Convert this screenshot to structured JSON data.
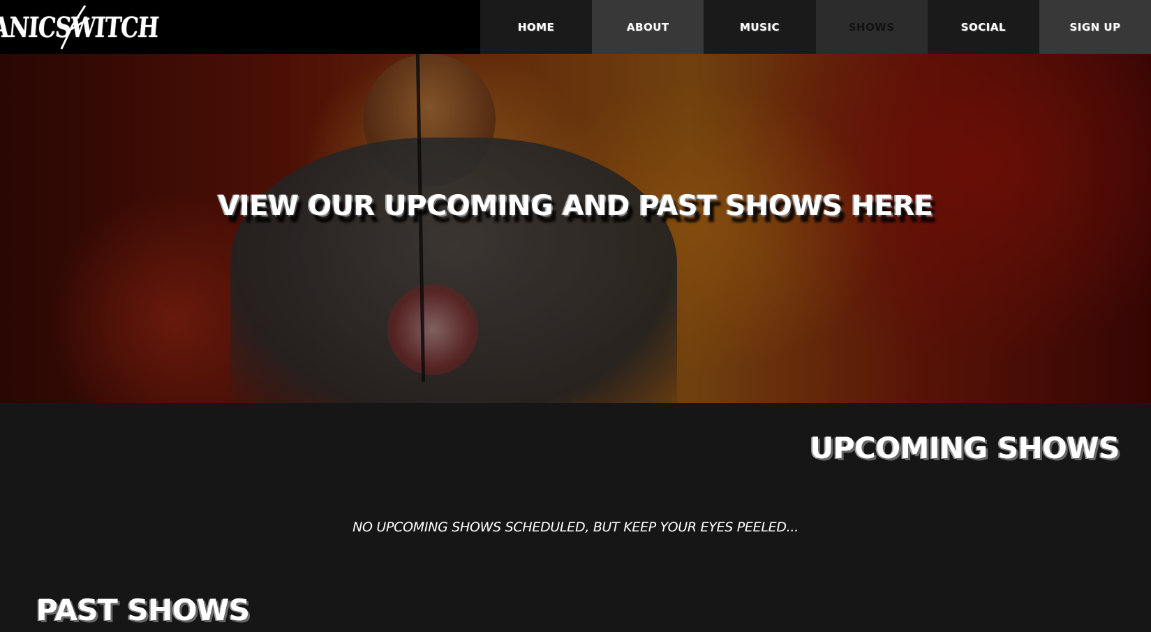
{
  "header": {
    "logo_text": "PANICSWITCH"
  },
  "nav": {
    "items": [
      {
        "label": "HOME"
      },
      {
        "label": "ABOUT"
      },
      {
        "label": "MUSIC"
      },
      {
        "label": "SHOWS",
        "active": true
      },
      {
        "label": "SOCIAL"
      },
      {
        "label": "SIGN UP"
      }
    ]
  },
  "hero": {
    "title": "VIEW OUR UPCOMING AND PAST SHOWS HERE"
  },
  "upcoming": {
    "heading": "UPCOMING SHOWS",
    "empty_message": "NO UPCOMING SHOWS SCHEDULED, BUT KEEP YOUR EYES PEELED..."
  },
  "past": {
    "heading": "PAST SHOWS"
  },
  "colors": {
    "nav_background": "#000000",
    "nav_dark": "#1a1a1a",
    "nav_mid": "#383838",
    "page_background": "#161616",
    "text": "#ffffff"
  }
}
